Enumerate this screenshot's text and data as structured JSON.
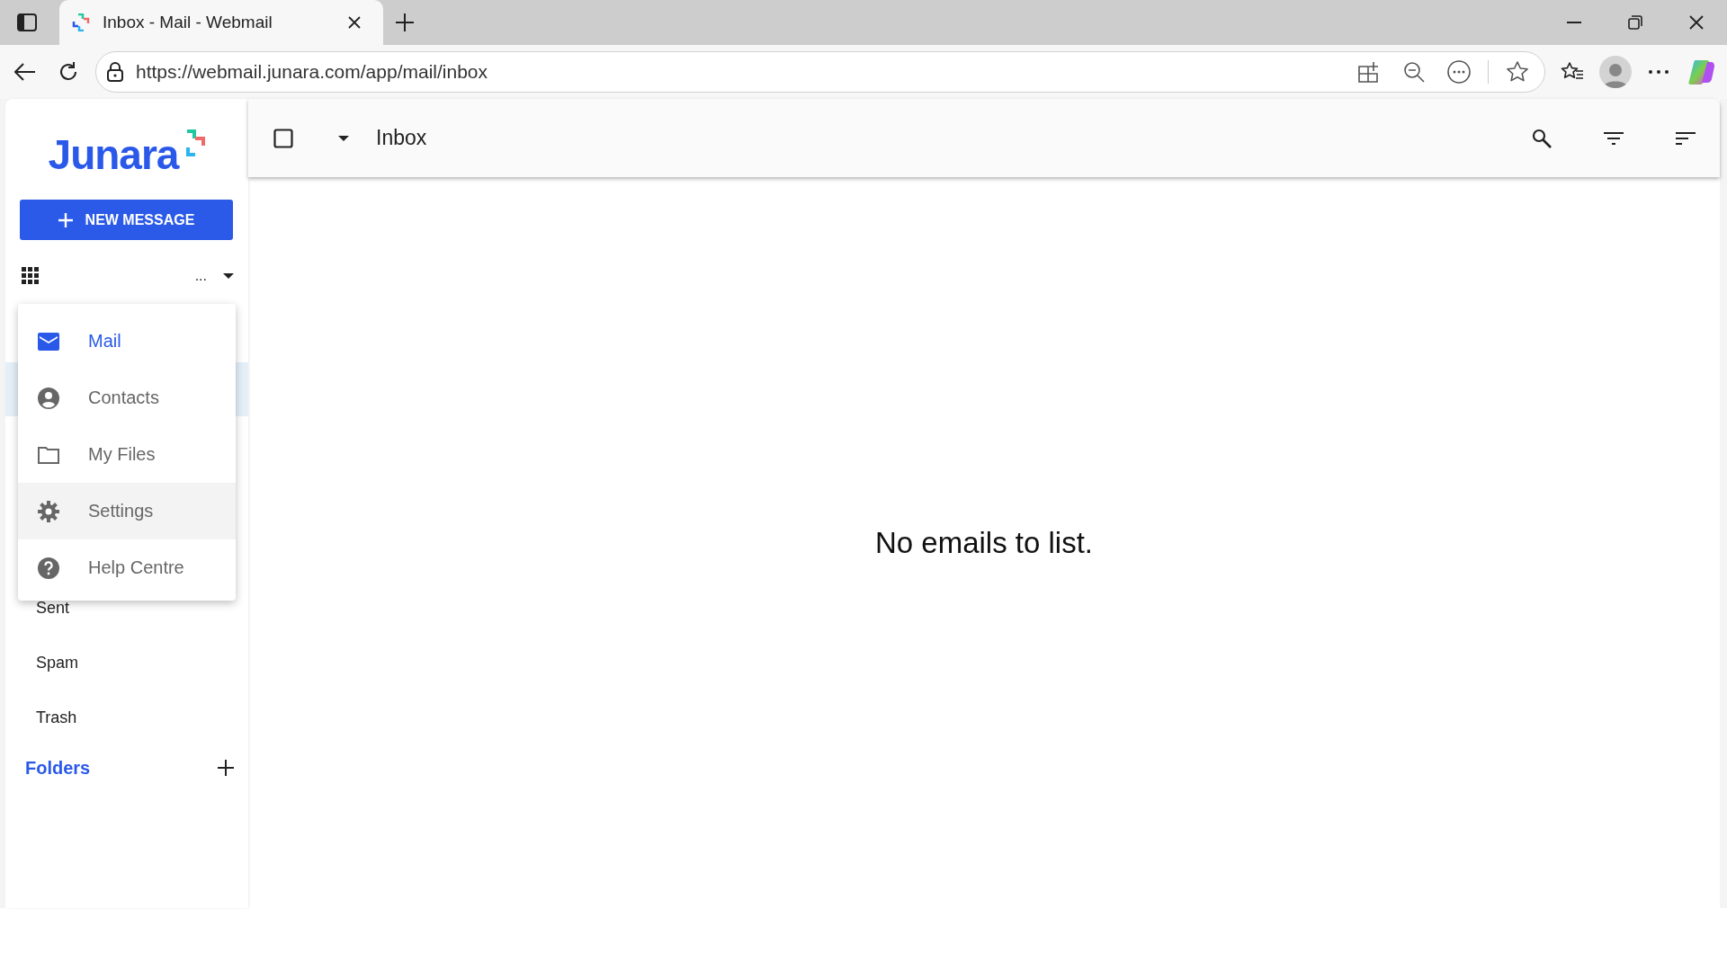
{
  "browser": {
    "tab": {
      "title": "Inbox - Mail - Webmail"
    },
    "address": "https://webmail.junara.com/app/mail/inbox"
  },
  "sidebar": {
    "logo": "Junara",
    "new_message": "NEW MESSAGE",
    "more": "...",
    "app_menu": [
      {
        "label": "Mail",
        "kind": "mail",
        "selected": true,
        "hovered": false
      },
      {
        "label": "Contacts",
        "kind": "contacts",
        "selected": false,
        "hovered": false
      },
      {
        "label": "My Files",
        "kind": "files",
        "selected": false,
        "hovered": false
      },
      {
        "label": "Settings",
        "kind": "settings",
        "selected": false,
        "hovered": true
      },
      {
        "label": "Help Centre",
        "kind": "help",
        "selected": false,
        "hovered": false
      }
    ],
    "folders": [
      {
        "label": "Sent"
      },
      {
        "label": "Spam"
      },
      {
        "label": "Trash"
      }
    ],
    "folders_heading": "Folders"
  },
  "toolbar": {
    "select_all": {
      "checked": false
    },
    "title": "Inbox"
  },
  "empty_message": "No emails to list."
}
